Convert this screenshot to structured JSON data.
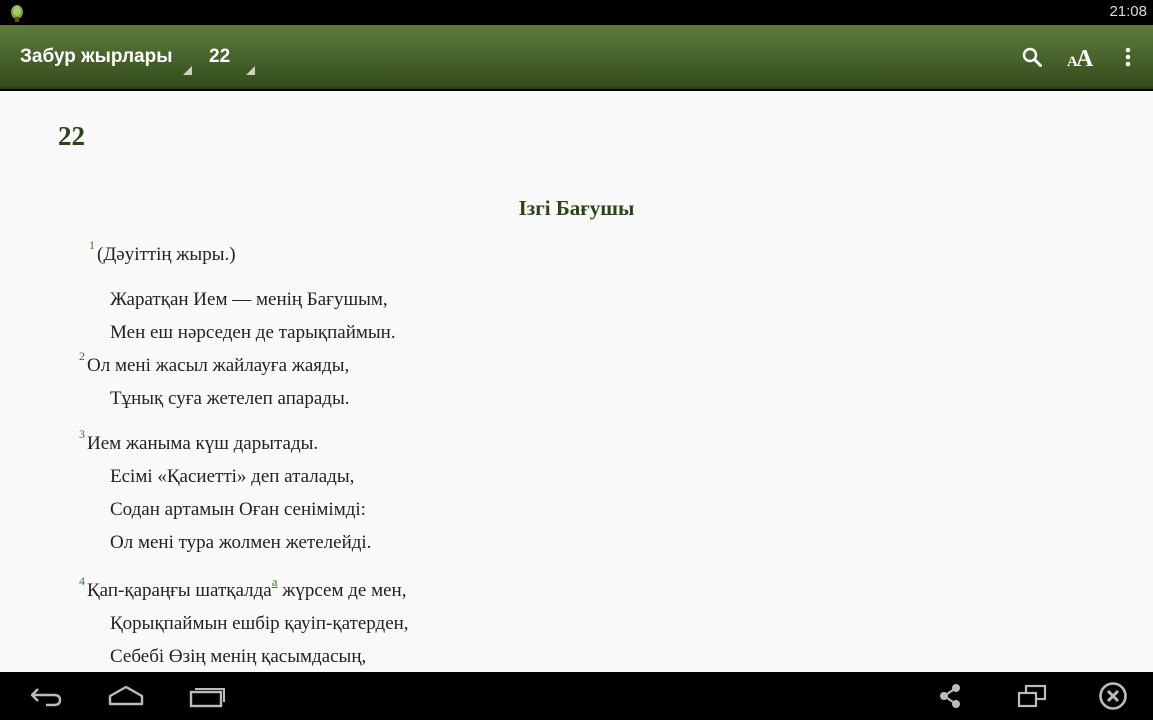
{
  "status_bar": {
    "time": "21:08"
  },
  "action_bar": {
    "book": "Забур жырлары",
    "chapter": "22",
    "font_icon_text": "AA"
  },
  "content": {
    "chapter_number": "22",
    "heading": "Ізгі Бағушы",
    "lines": [
      {
        "verse": "1",
        "text": "(Дәуіттің жыры.)"
      },
      {
        "verse": "",
        "text": "Жаратқан Ием — менің Бағушым,"
      },
      {
        "verse": "",
        "text": "Мен еш нәрседен де тарықпаймын."
      },
      {
        "verse": "2",
        "text": "Ол мені жасыл жайлауға жаяды,"
      },
      {
        "verse": "",
        "text": "Тұнық суға жетелеп апарады."
      },
      {
        "verse": "3",
        "text": "Ием жаныма күш дарытады."
      },
      {
        "verse": "",
        "text": "Есімі «Қасиетті» деп аталады,"
      },
      {
        "verse": "",
        "text": "Содан артамын Оған сенімімді:"
      },
      {
        "verse": "",
        "text": "Ол мені тура жолмен жетелейді."
      },
      {
        "verse": "4",
        "text_before": "Қап-қараңғы шатқалда",
        "footnote": "a",
        "text_after": " жүрсем де мен,"
      },
      {
        "verse": "",
        "text": "Қорықпаймын ешбір қауіп-қатерден,"
      },
      {
        "verse": "",
        "text": "Себебі Өзің менің қасымдасың,"
      }
    ]
  },
  "colors": {
    "action_bar": "#47622a",
    "heading": "#2b4514",
    "verse_number": "#3a7a28",
    "background": "#f9f9f9"
  }
}
